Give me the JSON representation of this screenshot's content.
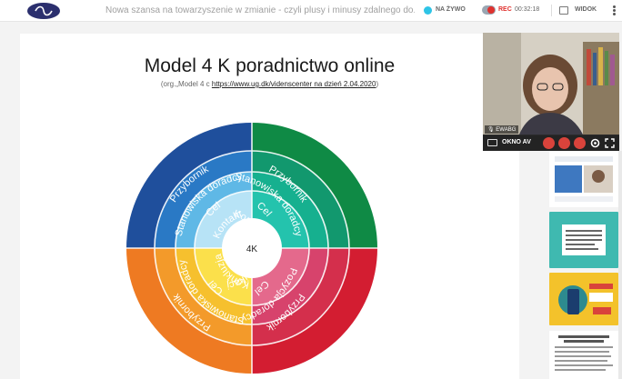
{
  "header": {
    "title": "Nowa szansa na towarzyszenie w zmianie - czyli plusy i minusy zdalnego do...",
    "live_label": "NA ŻYWO",
    "rec_label": "REC",
    "timer": "00:32:18",
    "view_label": "WIDOK"
  },
  "slide": {
    "title": "Model 4 K poradnictwo online",
    "subtitle_prefix": "(org.„Model 4 c",
    "subtitle_link": "https://www.ug.dk/videnscenter  na dzień 2.04.2020",
    "subtitle_suffix": ")",
    "wheel": {
      "center": "4K",
      "top_left": [
        "Kontakt",
        "Cel",
        "Stanowiska doradcy",
        "Przybornik"
      ],
      "top_right": [
        "Kontrakt",
        "Cel",
        "Stanowiska doradcy",
        "Przybornik"
      ],
      "bottom_left": [
        "Konkluzja",
        "Cel",
        "Stanowiska doradcy",
        "Przybornik"
      ],
      "bottom_right": [
        "Komunikacja",
        "Cel",
        "Pozycja doradcy",
        "Przybornik"
      ]
    }
  },
  "video": {
    "participant": "EWABG",
    "window_label": "OKNO AV"
  },
  "colors": {
    "q_top_left": [
      "#b7e3f6",
      "#5fb8e6",
      "#2a79c5",
      "#1f4f9c"
    ],
    "q_top_right": [
      "#24c3ad",
      "#16b08f",
      "#12986e",
      "#0f8a45"
    ],
    "q_bottom_left": [
      "#fbe04b",
      "#f6c02e",
      "#f39a2a",
      "#ee7a22"
    ],
    "q_bottom_right": [
      "#e4698c",
      "#d7436c",
      "#d42f4c",
      "#d31d31"
    ],
    "accent_live": "#2ec4e6",
    "accent_rec": "#e0312e"
  }
}
